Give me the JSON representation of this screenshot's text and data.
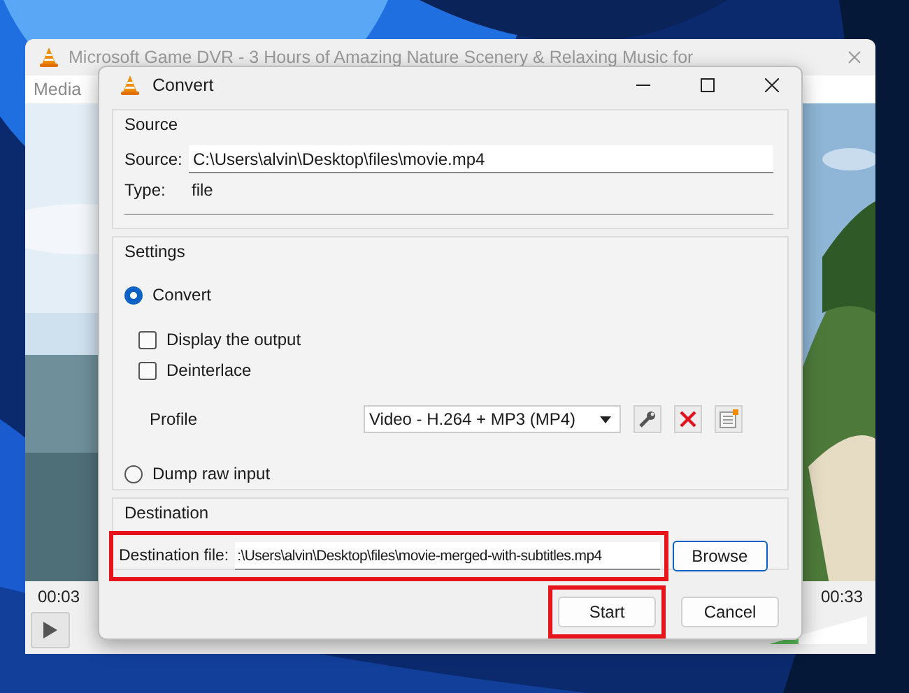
{
  "main_window": {
    "title": "Microsoft Game DVR - 3 Hours of Amazing Nature Scenery & Relaxing Music for",
    "menu": [
      "Media"
    ],
    "elapsed": "00:03",
    "total": "00:33",
    "volume": {
      "level": 0.3
    }
  },
  "dialog": {
    "title": "Convert",
    "source": {
      "heading": "Source",
      "source_label": "Source:",
      "source_value": "C:\\Users\\alvin\\Desktop\\files\\movie.mp4",
      "type_label": "Type:",
      "type_value": "file"
    },
    "settings": {
      "heading": "Settings",
      "options": [
        {
          "kind": "radio",
          "label": "Convert",
          "selected": true
        },
        {
          "kind": "checkbox",
          "label": "Display the output",
          "checked": false
        },
        {
          "kind": "checkbox",
          "label": "Deinterlace",
          "checked": false
        },
        {
          "kind": "profile",
          "label": "Profile",
          "value": "Video - H.264 + MP3 (MP4)"
        },
        {
          "kind": "radio",
          "label": "Dump raw input",
          "selected": false
        }
      ]
    },
    "destination": {
      "heading": "Destination",
      "label": "Destination file:",
      "value": ":\\Users\\alvin\\Desktop\\files\\movie-merged-with-subtitles.mp4",
      "highlighted": true,
      "browse": "Browse"
    },
    "buttons": [
      {
        "label": "Start",
        "highlighted": true
      },
      {
        "label": "Cancel",
        "highlighted": false
      }
    ]
  }
}
